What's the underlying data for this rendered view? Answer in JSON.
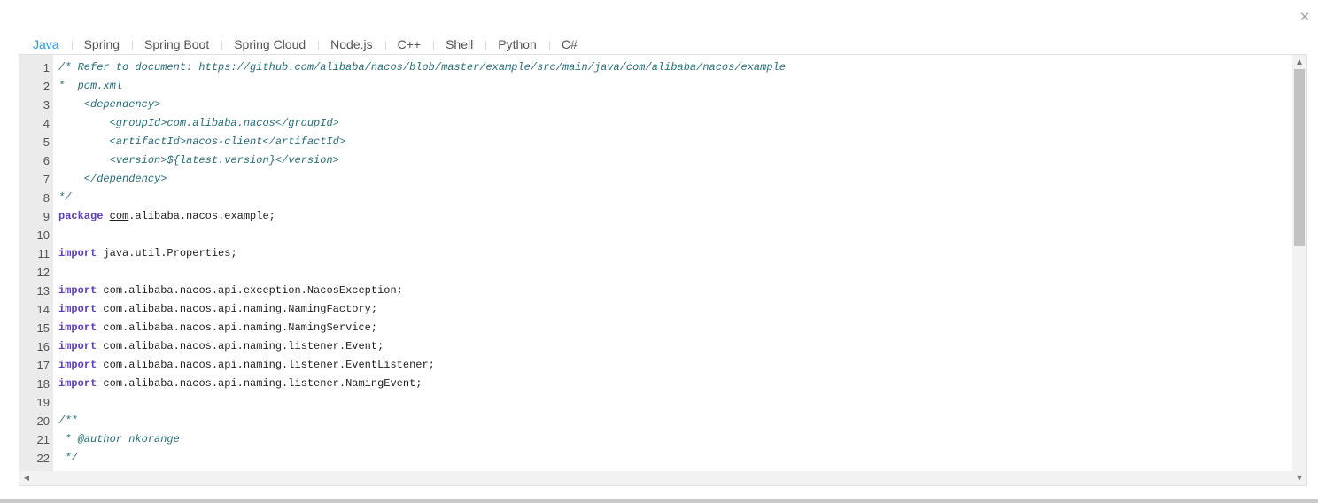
{
  "dialog": {
    "close_glyph": "✕"
  },
  "tabs": [
    {
      "label": "Java",
      "active": true
    },
    {
      "label": "Spring"
    },
    {
      "label": "Spring Boot"
    },
    {
      "label": "Spring Cloud"
    },
    {
      "label": "Node.js"
    },
    {
      "label": "C++"
    },
    {
      "label": "Shell"
    },
    {
      "label": "Python"
    },
    {
      "label": "C#"
    }
  ],
  "editor": {
    "lines": [
      {
        "n": "1",
        "parts": [
          {
            "t": "/* Refer to document: https://github.com/alibaba/nacos/blob/master/example/src/main/java/com/alibaba/nacos/example",
            "c": "c"
          }
        ]
      },
      {
        "n": "2",
        "parts": [
          {
            "t": "*  pom.xml",
            "c": "c"
          }
        ]
      },
      {
        "n": "3",
        "parts": [
          {
            "t": "    <dependency>",
            "c": "c"
          }
        ]
      },
      {
        "n": "4",
        "parts": [
          {
            "t": "        <groupId>com.alibaba.nacos</groupId>",
            "c": "c"
          }
        ]
      },
      {
        "n": "5",
        "parts": [
          {
            "t": "        <artifactId>nacos-client</artifactId>",
            "c": "c"
          }
        ]
      },
      {
        "n": "6",
        "parts": [
          {
            "t": "        <version>${latest.version}</version>",
            "c": "c"
          }
        ]
      },
      {
        "n": "7",
        "parts": [
          {
            "t": "    </dependency>",
            "c": "c"
          }
        ]
      },
      {
        "n": "8",
        "parts": [
          {
            "t": "*/",
            "c": "c"
          }
        ]
      },
      {
        "n": "9",
        "parts": [
          {
            "t": "package",
            "c": "k"
          },
          {
            "t": " "
          },
          {
            "t": "com",
            "c": "u"
          },
          {
            "t": ".alibaba.nacos.example;"
          }
        ]
      },
      {
        "n": "10",
        "parts": []
      },
      {
        "n": "11",
        "parts": [
          {
            "t": "import",
            "c": "k"
          },
          {
            "t": " java.util.Properties;"
          }
        ]
      },
      {
        "n": "12",
        "parts": []
      },
      {
        "n": "13",
        "parts": [
          {
            "t": "import",
            "c": "k"
          },
          {
            "t": " com.alibaba.nacos.api.exception.NacosException;"
          }
        ]
      },
      {
        "n": "14",
        "parts": [
          {
            "t": "import",
            "c": "k"
          },
          {
            "t": " com.alibaba.nacos.api.naming.NamingFactory;"
          }
        ]
      },
      {
        "n": "15",
        "parts": [
          {
            "t": "import",
            "c": "k"
          },
          {
            "t": " com.alibaba.nacos.api.naming.NamingService;"
          }
        ]
      },
      {
        "n": "16",
        "parts": [
          {
            "t": "import",
            "c": "k"
          },
          {
            "t": " com.alibaba.nacos.api.naming.listener.Event;"
          }
        ]
      },
      {
        "n": "17",
        "parts": [
          {
            "t": "import",
            "c": "k"
          },
          {
            "t": " com.alibaba.nacos.api.naming.listener.EventListener;"
          }
        ]
      },
      {
        "n": "18",
        "parts": [
          {
            "t": "import",
            "c": "k"
          },
          {
            "t": " com.alibaba.nacos.api.naming.listener.NamingEvent;"
          }
        ]
      },
      {
        "n": "19",
        "parts": []
      },
      {
        "n": "20",
        "parts": [
          {
            "t": "/**",
            "c": "c"
          }
        ]
      },
      {
        "n": "21",
        "parts": [
          {
            "t": " * @author nkorange",
            "c": "c"
          }
        ]
      },
      {
        "n": "22",
        "parts": [
          {
            "t": " */",
            "c": "c"
          }
        ]
      }
    ],
    "scroll_up": "▲",
    "scroll_down": "▼",
    "scroll_left": "◀",
    "scroll_right": "▶"
  }
}
